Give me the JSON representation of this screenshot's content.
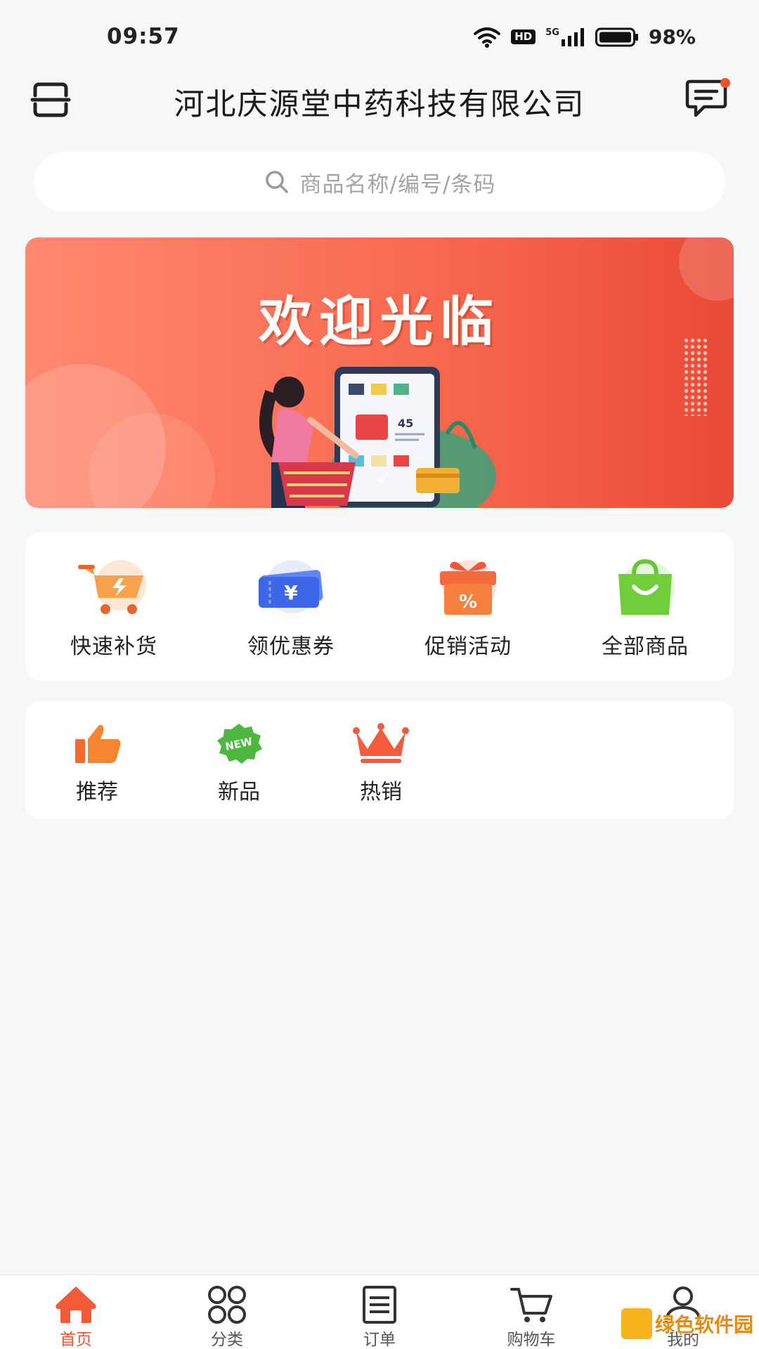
{
  "status_bar": {
    "time": "09:57",
    "network_badge": "HD",
    "signal_label": "5G",
    "battery_percent": "98%",
    "icons": [
      "wifi-icon",
      "hd-icon",
      "5g-signal-icon",
      "battery-icon"
    ]
  },
  "header": {
    "title": "河北庆源堂中药科技有限公司",
    "left_icon": "scan-icon",
    "right_icon": "message-icon",
    "has_unread_dot": true
  },
  "search": {
    "placeholder": "商品名称/编号/条码",
    "icon": "search-icon"
  },
  "banner": {
    "title": "欢迎光临",
    "illustration_price": "45"
  },
  "quick_actions": [
    {
      "label": "快速补货",
      "icon": "cart-bolt-icon"
    },
    {
      "label": "领优惠券",
      "icon": "coupon-icon"
    },
    {
      "label": "促销活动",
      "icon": "gift-percent-icon"
    },
    {
      "label": "全部商品",
      "icon": "shopping-bag-icon"
    }
  ],
  "tags": [
    {
      "label": "推荐",
      "icon": "thumbs-up-icon"
    },
    {
      "label": "新品",
      "icon": "new-badge-icon",
      "badge_text": "NEW"
    },
    {
      "label": "热销",
      "icon": "crown-icon"
    }
  ],
  "bottom_nav": [
    {
      "label": "首页",
      "icon": "home-icon",
      "active": true
    },
    {
      "label": "分类",
      "icon": "grid-icon",
      "active": false
    },
    {
      "label": "订单",
      "icon": "order-list-icon",
      "active": false
    },
    {
      "label": "购物车",
      "icon": "cart-icon",
      "active": false
    },
    {
      "label": "我的",
      "icon": "user-icon",
      "active": false
    }
  ],
  "watermark": {
    "text": "绿色软件园"
  },
  "colors": {
    "accent": "#f0532f",
    "banner_start": "#ff8870",
    "banner_end": "#ea4a36",
    "background": "#f7f7f8"
  }
}
